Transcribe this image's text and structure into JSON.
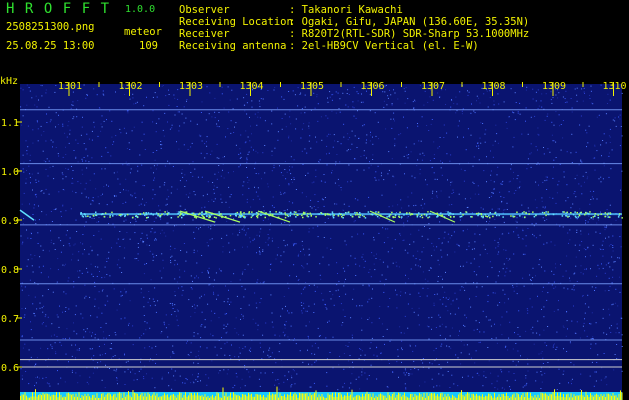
{
  "header": {
    "app_title": "HROFFT",
    "app_version": "1.0.0",
    "file_name": "2508251300.png",
    "meteor_label": "meteor",
    "date_time": "25.08.25 13:00",
    "meteor_count": "109",
    "info": [
      {
        "label": "Observer",
        "value": ": Takanori Kawachi"
      },
      {
        "label": "Receiving Location",
        "value": ": Ogaki, Gifu, JAPAN (136.60E, 35.35N)"
      },
      {
        "label": "Receiver",
        "value": ": R820T2(RTL-SDR) SDR-Sharp 53.1000MHz"
      },
      {
        "label": "Receiving antenna",
        "value": ": 2el-HB9CV Vertical (el. E-W)"
      }
    ]
  },
  "chart_data": {
    "type": "heatmap",
    "ylabel": "kHz",
    "x_ticks": [
      "1301",
      "1302",
      "1303",
      "1304",
      "1305",
      "1306",
      "1307",
      "1308",
      "1309",
      "1310"
    ],
    "y_ticks": [
      "1.1",
      "1.0",
      "0.9",
      "0.8",
      "0.7",
      "0.6"
    ],
    "ylim": [
      0.6,
      1.15
    ],
    "colors": {
      "background": "#0a1470",
      "noise": "#3a5cff",
      "signal": "#a8ff60",
      "ticks": "#f2f200",
      "bottom_bars": "#ffff00",
      "bottom_band": "#18c8ff"
    }
  }
}
